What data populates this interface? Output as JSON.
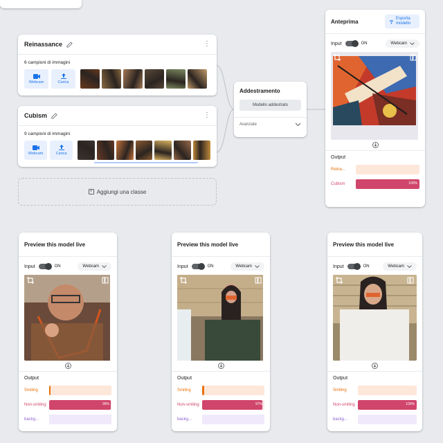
{
  "classes": [
    {
      "title": "Reinassance",
      "samples": "6 campioni di immagini",
      "webcam": "Webcam",
      "upload": "Carica",
      "thumbs": [
        "#6b3a1e",
        "#8a6a40",
        "#a37a55",
        "#5a4a3a",
        "#7b8a60",
        "#c29a6a"
      ]
    },
    {
      "title": "Cubism",
      "samples": "9 campioni di immagini",
      "webcam": "Webcam",
      "upload": "Carica",
      "thumbs": [
        "#3a3330",
        "#6a3a25",
        "#c4733a",
        "#8a5a30",
        "#d8b060",
        "#9a6a4a",
        "#c08a3a"
      ]
    }
  ],
  "add_class": "Aggiungi una classe",
  "training": {
    "title": "Addestramento",
    "button": "Modello addestrato",
    "advanced": "Avanzate"
  },
  "main_preview": {
    "title": "Anteprima",
    "export": "Esporta modello",
    "input": "Input",
    "on": "ON",
    "camera": "Webcam",
    "output": "Output",
    "results": [
      {
        "label": "Reina...",
        "value": 0,
        "text": "",
        "color": "#e8710a",
        "track": "#fde7d9"
      },
      {
        "label": "Cubism",
        "value": 100,
        "text": "100%",
        "color": "#d0456b",
        "track": "#fbe4ea"
      }
    ]
  },
  "live_previews": [
    {
      "title": "Preview this model live",
      "input": "Input",
      "on": "ON",
      "camera": "Webcam",
      "output": "Output",
      "results": [
        {
          "label": "Smiling",
          "value": 1,
          "text": "",
          "color": "#e8710a",
          "track": "#fde7d9"
        },
        {
          "label": "Non-smiling",
          "value": 99,
          "text": "99%",
          "color": "#d0456b",
          "track": "#fbe4ea"
        },
        {
          "label": "backg...",
          "value": 0,
          "text": "",
          "color": "#8e63ce",
          "track": "#efe9fb"
        }
      ]
    },
    {
      "title": "Preview this model live",
      "input": "Input",
      "on": "ON",
      "camera": "Webcam",
      "output": "Output",
      "results": [
        {
          "label": "Smiling",
          "value": 3,
          "text": "",
          "color": "#e8710a",
          "track": "#fde7d9"
        },
        {
          "label": "Non-smiling",
          "value": 97,
          "text": "97%",
          "color": "#d0456b",
          "track": "#fbe4ea"
        },
        {
          "label": "backg...",
          "value": 0,
          "text": "",
          "color": "#8e63ce",
          "track": "#efe9fb"
        }
      ]
    },
    {
      "title": "Preview this model live",
      "input": "Input",
      "on": "ON",
      "camera": "Webcam",
      "output": "Output",
      "results": [
        {
          "label": "Smiling",
          "value": 0,
          "text": "",
          "color": "#e8710a",
          "track": "#fde7d9"
        },
        {
          "label": "Non-smiling",
          "value": 100,
          "text": "100%",
          "color": "#d0456b",
          "track": "#fbe4ea"
        },
        {
          "label": "backg...",
          "value": 0,
          "text": "",
          "color": "#8e63ce",
          "track": "#efe9fb"
        }
      ]
    }
  ],
  "icons": {
    "edit": "pencil-icon",
    "menu": "more-vert-icon",
    "webcam": "videocam-icon",
    "upload": "upload-icon",
    "add": "add-box-icon",
    "expand": "chevron-down-icon",
    "export": "broadcast-icon",
    "crop": "crop-icon",
    "flip": "flip-icon",
    "arrow": "arrow-down-circle-icon"
  }
}
